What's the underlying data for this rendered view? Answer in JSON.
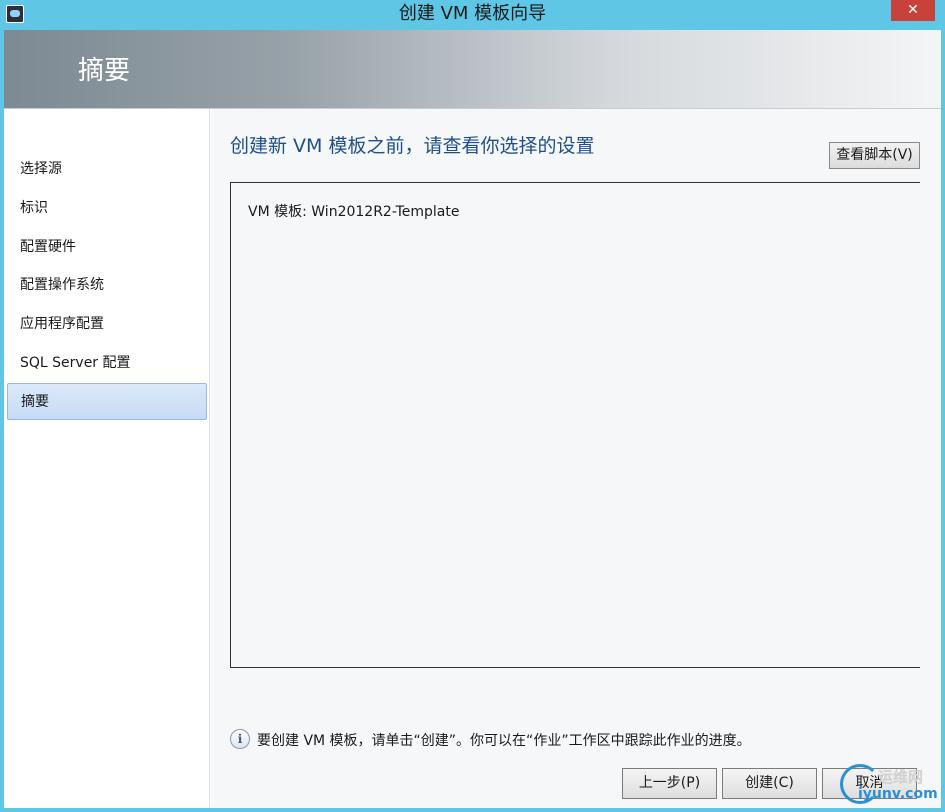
{
  "window": {
    "title": "创建 VM 模板向导",
    "close_symbol": "✕"
  },
  "banner": {
    "title": "摘要"
  },
  "nav": {
    "items": [
      {
        "label": "选择源"
      },
      {
        "label": "标识"
      },
      {
        "label": "配置硬件"
      },
      {
        "label": "配置操作系统"
      },
      {
        "label": "应用程序配置"
      },
      {
        "label": "SQL Server 配置"
      },
      {
        "label": "摘要",
        "selected": true
      }
    ]
  },
  "main": {
    "heading": "创建新 VM 模板之前，请查看你选择的设置",
    "view_script_label": "查看脚本(V)",
    "summary_line": "VM 模板: Win2012R2-Template",
    "info_icon": "i",
    "info_text": "要创建 VM 模板，请单击“创建”。你可以在“作业”工作区中跟踪此作业的进度。"
  },
  "footer": {
    "back_label": "上一步(P)",
    "create_label": "创建(C)",
    "cancel_label": "取消"
  },
  "watermark": {
    "top": "运维网",
    "bottom": "iyunv.com"
  },
  "colors": {
    "frame": "#5fc6e6",
    "heading": "#1e4f8a",
    "close": "#c7423a",
    "selected": "#c6dcf6"
  },
  "icons": {
    "app": "app-icon",
    "info": "info-icon"
  }
}
